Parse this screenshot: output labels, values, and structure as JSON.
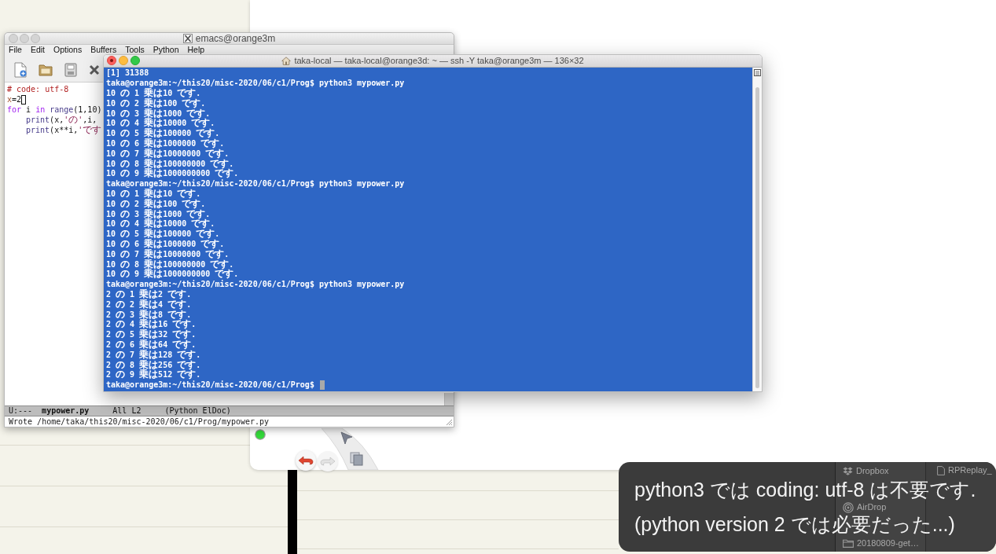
{
  "emacs": {
    "title": "emacs@orange3m",
    "menu": [
      "File",
      "Edit",
      "Options",
      "Buffers",
      "Tools",
      "Python",
      "Help"
    ],
    "code_lines": [
      {
        "cursor": false,
        "tokens": [
          {
            "kind": "comment",
            "text": "# code: utf-8"
          }
        ]
      },
      {
        "cursor": true,
        "tokens": [
          {
            "kind": "variable",
            "text": "x"
          },
          {
            "kind": "plain",
            "text": "=2"
          }
        ]
      },
      {
        "cursor": false,
        "tokens": [
          {
            "kind": "keyword",
            "text": "for"
          },
          {
            "kind": "plain",
            "text": " i "
          },
          {
            "kind": "keyword",
            "text": "in"
          },
          {
            "kind": "builtin",
            "text": " range"
          },
          {
            "kind": "plain",
            "text": "(1,10)"
          }
        ],
        "children": [
          {
            "cursor": false,
            "tokens": [
              {
                "kind": "builtin",
                "text": "print"
              },
              {
                "kind": "plain",
                "text": "(x,"
              },
              {
                "kind": "string",
                "text": "'の'"
              },
              {
                "kind": "plain",
                "text": ",i,"
              }
            ]
          },
          {
            "cursor": false,
            "tokens": [
              {
                "kind": "builtin",
                "text": "print"
              },
              {
                "kind": "plain",
                "text": "(x**i,"
              },
              {
                "kind": "string",
                "text": "'です"
              }
            ]
          }
        ]
      }
    ],
    "mode_line": {
      "status": "U:---",
      "buffer": "mypower.py",
      "position": "All L2",
      "modes": "(Python ElDoc)"
    },
    "echo_area": "Wrote /home/taka/this20/misc-2020/06/c1/Prog/mypower.py"
  },
  "terminal": {
    "title": "taka-local — taka-local@orange3d: ~ — ssh -Y taka@orange3m — 136×32",
    "lines": [
      {
        "text": "[1] 31388",
        "cursor": false
      },
      {
        "text": "taka@orange3m:~/this20/misc-2020/06/c1/Prog$ python3 mypower.py",
        "cursor": false
      },
      {
        "text": "10 の 1 乗は10 です.",
        "cursor": false
      },
      {
        "text": "10 の 2 乗は100 です.",
        "cursor": false
      },
      {
        "text": "10 の 3 乗は1000 です.",
        "cursor": false
      },
      {
        "text": "10 の 4 乗は10000 です.",
        "cursor": false
      },
      {
        "text": "10 の 5 乗は100000 です.",
        "cursor": false
      },
      {
        "text": "10 の 6 乗は1000000 です.",
        "cursor": false
      },
      {
        "text": "10 の 7 乗は10000000 です.",
        "cursor": false
      },
      {
        "text": "10 の 8 乗は100000000 です.",
        "cursor": false
      },
      {
        "text": "10 の 9 乗は1000000000 です.",
        "cursor": false
      },
      {
        "text": "taka@orange3m:~/this20/misc-2020/06/c1/Prog$ python3 mypower.py",
        "cursor": false
      },
      {
        "text": "10 の 1 乗は10 です.",
        "cursor": false
      },
      {
        "text": "10 の 2 乗は100 です.",
        "cursor": false
      },
      {
        "text": "10 の 3 乗は1000 です.",
        "cursor": false
      },
      {
        "text": "10 の 4 乗は10000 です.",
        "cursor": false
      },
      {
        "text": "10 の 5 乗は100000 です.",
        "cursor": false
      },
      {
        "text": "10 の 6 乗は1000000 です.",
        "cursor": false
      },
      {
        "text": "10 の 7 乗は10000000 です.",
        "cursor": false
      },
      {
        "text": "10 の 8 乗は100000000 です.",
        "cursor": false
      },
      {
        "text": "10 の 9 乗は1000000000 です.",
        "cursor": false
      },
      {
        "text": "taka@orange3m:~/this20/misc-2020/06/c1/Prog$ python3 mypower.py",
        "cursor": false
      },
      {
        "text": "2 の 1 乗は2 です.",
        "cursor": false
      },
      {
        "text": "2 の 2 乗は4 です.",
        "cursor": false
      },
      {
        "text": "2 の 3 乗は8 です.",
        "cursor": false
      },
      {
        "text": "2 の 4 乗は16 です.",
        "cursor": false
      },
      {
        "text": "2 の 5 乗は32 です.",
        "cursor": false
      },
      {
        "text": "2 の 6 乗は64 です.",
        "cursor": false
      },
      {
        "text": "2 の 7 乗は128 です.",
        "cursor": false
      },
      {
        "text": "2 の 8 乗は256 です.",
        "cursor": false
      },
      {
        "text": "2 の 9 乗は512 です.",
        "cursor": false
      },
      {
        "text": "taka@orange3m:~/this20/misc-2020/06/c1/Prog$",
        "cursor": true
      }
    ]
  },
  "finder": {
    "sidebar": [
      {
        "kind": "dropbox",
        "label": "Dropbox"
      },
      {
        "kind": "airdrop",
        "label": "AirDrop"
      },
      {
        "kind": "folder",
        "label": "20180809-get…"
      }
    ],
    "files": [
      {
        "label": "RPReplay_"
      }
    ]
  },
  "caption": {
    "lines": [
      "python3 では coding: utf-8 は不要です.",
      "(python version 2 では必要だった...)"
    ]
  }
}
